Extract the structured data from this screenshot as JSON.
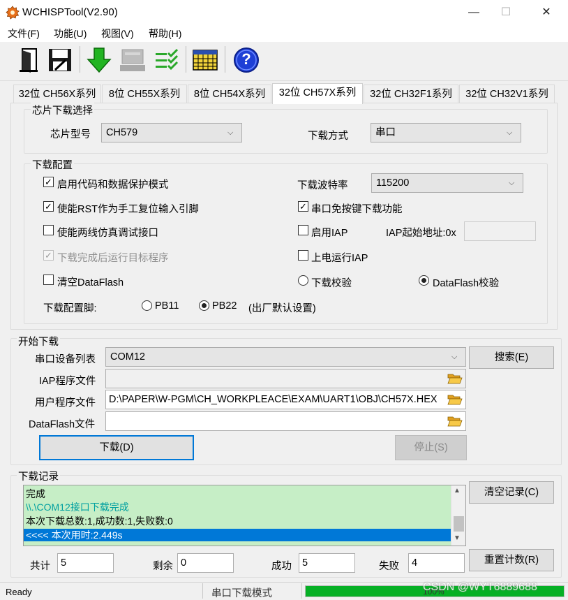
{
  "window": {
    "title": "WCHISPTool(V2.90)",
    "minimize": "—",
    "maximize": "☐",
    "close": "✕"
  },
  "menu": {
    "items": [
      {
        "label": "文件(F)"
      },
      {
        "label": "功能(U)"
      },
      {
        "label": "视图(V)"
      },
      {
        "label": "帮助(H)"
      }
    ]
  },
  "toolbar": {
    "icons": [
      "open-door-icon",
      "save-disk-icon",
      "download-arrow-icon",
      "disabled-device-icon",
      "checklist-icon",
      "calendar-grid-icon",
      "help-icon"
    ],
    "help_glyph": "?"
  },
  "tabs": [
    {
      "label": "32位 CH56X系列",
      "active": false
    },
    {
      "label": "8位 CH55X系列",
      "active": false
    },
    {
      "label": "8位 CH54X系列",
      "active": false
    },
    {
      "label": "32位 CH57X系列",
      "active": true
    },
    {
      "label": "32位 CH32F1系列",
      "active": false
    },
    {
      "label": "32位 CH32V1系列",
      "active": false
    }
  ],
  "chip_select": {
    "group_title": "芯片下载选择",
    "model_label": "芯片型号",
    "model_value": "CH579",
    "mode_label": "下载方式",
    "mode_value": "串口"
  },
  "download_config": {
    "group_title": "下载配置",
    "options": {
      "protect": {
        "label": "启用代码和数据保护模式",
        "checked": true
      },
      "rst": {
        "label": "使能RST作为手工复位输入引脚",
        "checked": true
      },
      "twowire": {
        "label": "使能两线仿真调试接口",
        "checked": false
      },
      "run_after": {
        "label": "下载完成后运行目标程序",
        "checked": true,
        "disabled": true
      },
      "clear_df": {
        "label": "清空DataFlash",
        "checked": false
      },
      "no_key": {
        "label": "串口免按键下载功能",
        "checked": true
      },
      "iap": {
        "label": "启用IAP",
        "checked": false
      },
      "power_iap": {
        "label": "上电运行IAP",
        "checked": false
      }
    },
    "baud_label": "下载波特率",
    "baud_value": "115200",
    "iap_addr_label": "IAP起始地址:0x",
    "iap_addr_value": "",
    "verify_download": {
      "label": "下载校验",
      "selected": false
    },
    "verify_dataflash": {
      "label": "DataFlash校验",
      "selected": true
    },
    "pin_label": "下载配置脚:",
    "pin_pb11": {
      "label": "PB11",
      "selected": false
    },
    "pin_pb22": {
      "label": "PB22",
      "selected": true
    },
    "pin_default_note": "(出厂默认设置)"
  },
  "start": {
    "group_title": "开始下载",
    "port_label": "串口设备列表",
    "port_value": "COM12",
    "search_button": "搜索(E)",
    "iap_file_label": "IAP程序文件",
    "iap_file_value": "",
    "user_file_label": "用户程序文件",
    "user_file_value": "D:\\PAPER\\W-PGM\\CH_WORKPLEACE\\EXAM\\UART1\\OBJ\\CH57X.HEX",
    "dataflash_label": "DataFlash文件",
    "dataflash_value": "",
    "download_button": "下载(D)",
    "stop_button": "停止(S)"
  },
  "log": {
    "group_title": "下载记录",
    "lines": [
      {
        "text": "完成",
        "color": "#000000"
      },
      {
        "text": "\\\\.\\COM12接口下载完成",
        "color": "#00a0a0"
      },
      {
        "text": "本次下载总数:1,成功数:1,失败数:0",
        "color": "#000000"
      },
      {
        "text": "<<<< 本次用时:2.449s",
        "color": "#ffffff",
        "selected": true
      }
    ],
    "clear_button": "清空记录(C)",
    "reset_button": "重置计数(R)"
  },
  "counters": {
    "total_label": "共计",
    "total_value": "5",
    "remain_label": "剩余",
    "remain_value": "0",
    "success_label": "成功",
    "success_value": "5",
    "fail_label": "失败",
    "fail_value": "4"
  },
  "status": {
    "left": "Ready",
    "mode": "串口下载模式",
    "progress_overlay": "100%",
    "progress": 1.0,
    "watermark": "CSDN @WYT6889688"
  },
  "colors": {
    "accent": "#0078d7",
    "log_bg": "#c6eec6",
    "progress": "#06b025"
  }
}
